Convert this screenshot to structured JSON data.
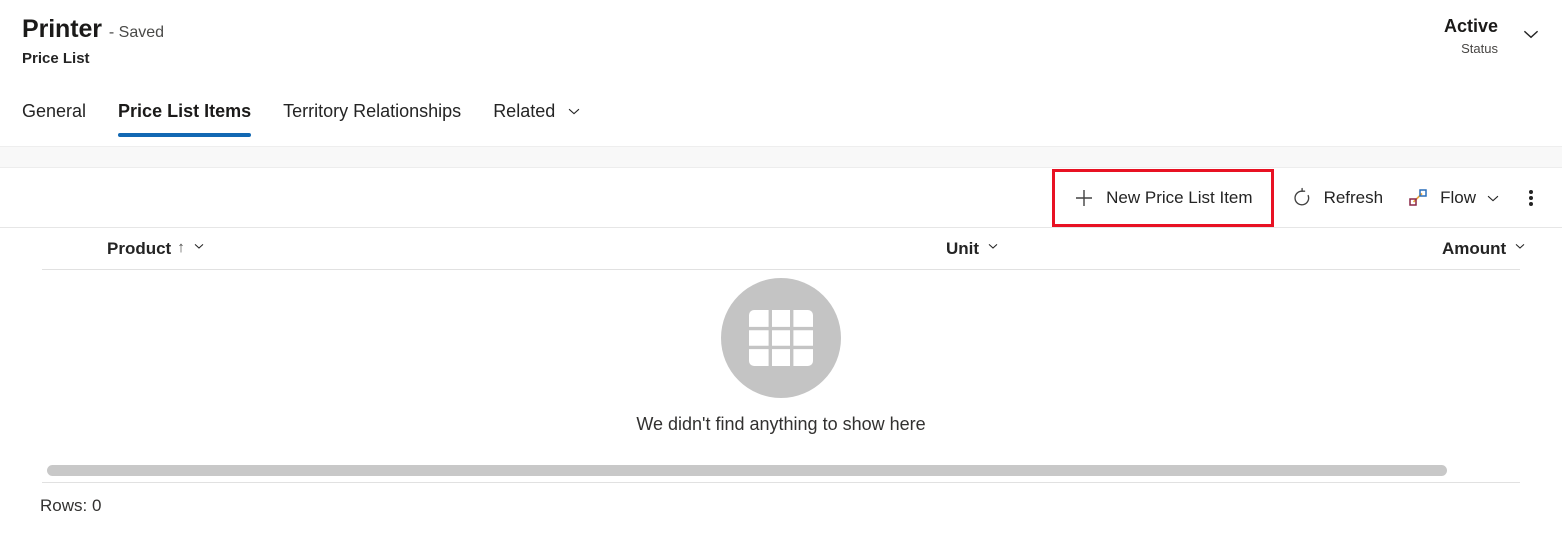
{
  "record": {
    "title": "Printer",
    "saved_state": "- Saved",
    "entity": "Price List"
  },
  "status": {
    "value": "Active",
    "label": "Status",
    "chevron_icon": "chevron-down-icon"
  },
  "tabs": [
    {
      "label": "General",
      "active": false,
      "has_chevron": false
    },
    {
      "label": "Price List Items",
      "active": true,
      "has_chevron": false
    },
    {
      "label": "Territory Relationships",
      "active": false,
      "has_chevron": false
    },
    {
      "label": "Related",
      "active": false,
      "has_chevron": true
    }
  ],
  "commands": {
    "new_item": {
      "label": "New Price List Item",
      "icon": "plus-icon",
      "highlighted": true
    },
    "refresh": {
      "label": "Refresh",
      "icon": "refresh-icon"
    },
    "flow": {
      "label": "Flow",
      "icon": "power-automate-flow-icon",
      "chevron_icon": "chevron-down-icon"
    },
    "overflow": {
      "icon": "more-vertical-icon"
    }
  },
  "grid": {
    "columns": [
      {
        "label": "Product",
        "sort": "↑",
        "chevron_icon": "chevron-down-icon"
      },
      {
        "label": "Unit",
        "sort": "",
        "chevron_icon": "chevron-down-icon"
      },
      {
        "label": "Amount",
        "sort": "",
        "chevron_icon": "chevron-down-icon"
      }
    ],
    "rows": [],
    "empty_message": "We didn't find anything to show here",
    "empty_icon": "table-grid-icon",
    "footer": "Rows: 0"
  },
  "colors": {
    "accent_blue": "#1268b3",
    "highlight_red": "#e81123",
    "empty_circle_gray": "#c4c4c4"
  }
}
